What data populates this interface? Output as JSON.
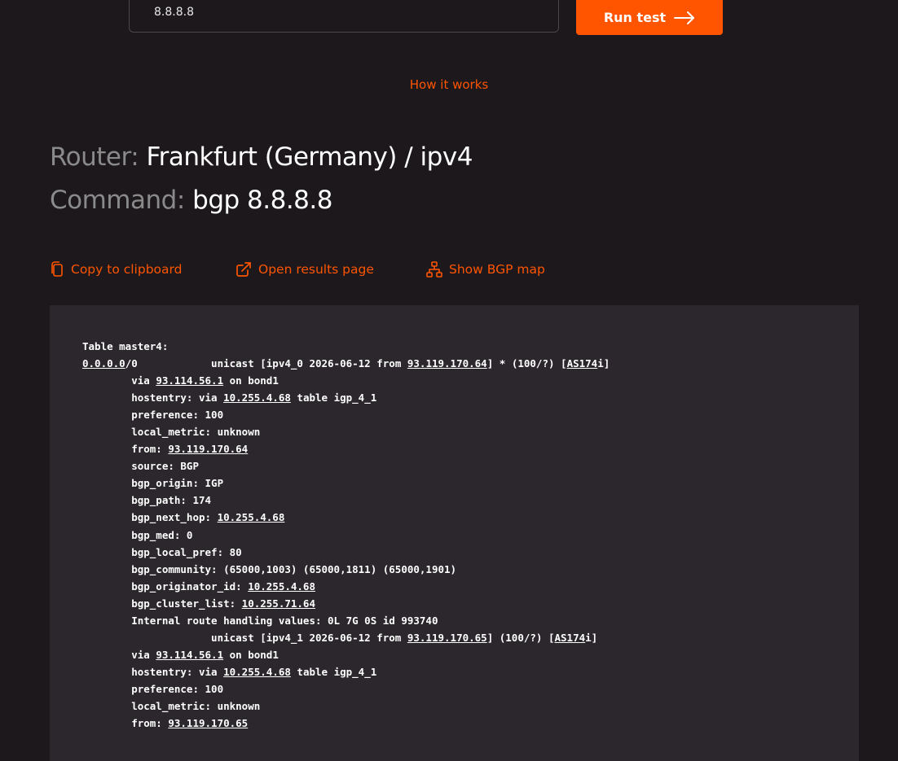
{
  "search": {
    "value": "8.8.8.8"
  },
  "run_button": {
    "label": "Run test",
    "icon": "arrow-right-icon"
  },
  "how_it_works": "How it works",
  "router": {
    "label": "Router:",
    "value": "Frankfurt (Germany) / ipv4"
  },
  "command": {
    "label": "Command:",
    "value": "bgp 8.8.8.8"
  },
  "actions": {
    "copy": "Copy to clipboard",
    "open": "Open results page",
    "map": "Show BGP map"
  },
  "colors": {
    "accent": "#ff5500",
    "background": "#1c181c",
    "panel": "#2b272c"
  },
  "output_lines": [
    [
      {
        "t": "Table master4:"
      }
    ],
    [
      {
        "t": "0.0.0.0",
        "link": true
      },
      {
        "t": "/0            unicast [ipv4_0 2026-06-12 from "
      },
      {
        "t": "93.119.170.64",
        "link": true
      },
      {
        "t": "] * (100/?) ["
      },
      {
        "t": "AS174",
        "link": true
      },
      {
        "t": "i]"
      }
    ],
    [
      {
        "t": "        via "
      },
      {
        "t": "93.114.56.1",
        "link": true
      },
      {
        "t": " on bond1"
      }
    ],
    [
      {
        "t": "        hostentry: via "
      },
      {
        "t": "10.255.4.68",
        "link": true
      },
      {
        "t": " table igp_4_1"
      }
    ],
    [
      {
        "t": "        preference: 100"
      }
    ],
    [
      {
        "t": "        local_metric: unknown"
      }
    ],
    [
      {
        "t": "        from: "
      },
      {
        "t": "93.119.170.64",
        "link": true
      }
    ],
    [
      {
        "t": "        source: BGP"
      }
    ],
    [
      {
        "t": "        bgp_origin: IGP"
      }
    ],
    [
      {
        "t": "        bgp_path: 174"
      }
    ],
    [
      {
        "t": "        bgp_next_hop: "
      },
      {
        "t": "10.255.4.68",
        "link": true
      }
    ],
    [
      {
        "t": "        bgp_med: 0"
      }
    ],
    [
      {
        "t": "        bgp_local_pref: 80"
      }
    ],
    [
      {
        "t": "        bgp_community: (65000,1003) (65000,1811) (65000,1901)"
      }
    ],
    [
      {
        "t": "        bgp_originator_id: "
      },
      {
        "t": "10.255.4.68",
        "link": true
      }
    ],
    [
      {
        "t": "        bgp_cluster_list: "
      },
      {
        "t": "10.255.71.64",
        "link": true
      }
    ],
    [
      {
        "t": "        Internal route handling values: 0L 7G 0S id 993740"
      }
    ],
    [
      {
        "t": "                     unicast [ipv4_1 2026-06-12 from "
      },
      {
        "t": "93.119.170.65",
        "link": true
      },
      {
        "t": "] (100/?) ["
      },
      {
        "t": "AS174",
        "link": true
      },
      {
        "t": "i]"
      }
    ],
    [
      {
        "t": "        via "
      },
      {
        "t": "93.114.56.1",
        "link": true
      },
      {
        "t": " on bond1"
      }
    ],
    [
      {
        "t": "        hostentry: via "
      },
      {
        "t": "10.255.4.68",
        "link": true
      },
      {
        "t": " table igp_4_1"
      }
    ],
    [
      {
        "t": "        preference: 100"
      }
    ],
    [
      {
        "t": "        local_metric: unknown"
      }
    ],
    [
      {
        "t": "        from: "
      },
      {
        "t": "93.119.170.65",
        "link": true
      }
    ]
  ]
}
